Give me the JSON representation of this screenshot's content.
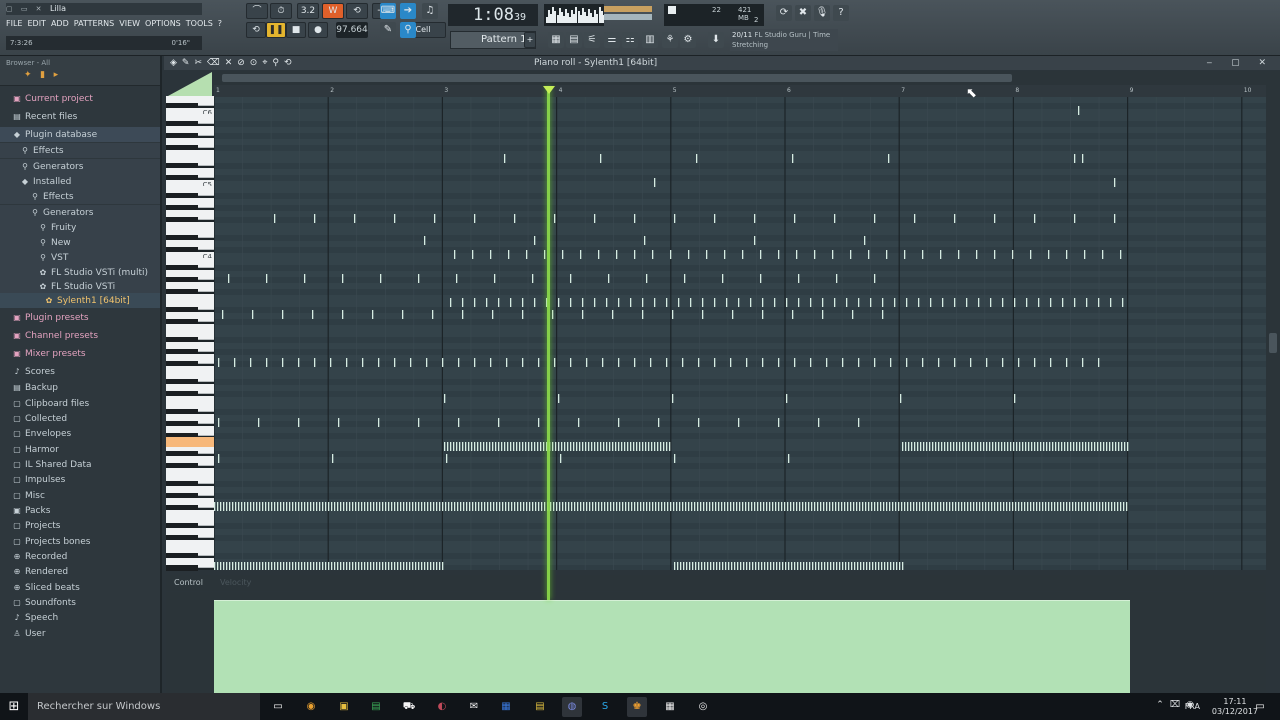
{
  "window": {
    "title": "Lilla",
    "controls": "▢ ▭ ✕"
  },
  "menu": [
    "FILE",
    "EDIT",
    "ADD",
    "PATTERNS",
    "VIEW",
    "OPTIONS",
    "TOOLS",
    "?"
  ],
  "hint": {
    "left": "7:3:26",
    "right": "0'16\""
  },
  "transport": {
    "tempo": "97.664",
    "time_main": "1:08",
    "time_sub": "39",
    "time_unit": "M:S:CS",
    "cell_label": "Cell",
    "beat_label": "3.2"
  },
  "cpu": {
    "a": "22",
    "b": "421 MB",
    "c": "2"
  },
  "pattern": {
    "label": "Pattern 1"
  },
  "news": {
    "counter": "20/11",
    "text": "FL Studio Guru | Time Stretching"
  },
  "browser": {
    "header": "Browser - All",
    "items": [
      {
        "label": "Current project",
        "icon": "▣",
        "kind": "pink"
      },
      {
        "label": "Recent files",
        "icon": "▤",
        "kind": "normal"
      },
      {
        "label": "Plugin database",
        "icon": "◆",
        "kind": "hdr"
      },
      {
        "label": "Effects",
        "icon": "⚲",
        "kind": "sub"
      },
      {
        "label": "Generators",
        "icon": "⚲",
        "kind": "sub"
      },
      {
        "label": "Installed",
        "icon": "◆",
        "kind": "sub"
      },
      {
        "label": "Effects",
        "icon": "⚲",
        "kind": "sub"
      },
      {
        "label": "Generators",
        "icon": "⚲",
        "kind": "sub"
      },
      {
        "label": "Fruity",
        "icon": "⚲",
        "kind": "sub"
      },
      {
        "label": "New",
        "icon": "⚲",
        "kind": "sub"
      },
      {
        "label": "VST",
        "icon": "⚲",
        "kind": "sub"
      },
      {
        "label": "FL Studio VSTi (multi)",
        "icon": "✿",
        "kind": "sub"
      },
      {
        "label": "FL Studio VSTi",
        "icon": "✿",
        "kind": "sub"
      },
      {
        "label": "Sylenth1 [64bit]",
        "icon": "✿",
        "kind": "sel"
      },
      {
        "label": "Plugin presets",
        "icon": "▣",
        "kind": "pink"
      },
      {
        "label": "Channel presets",
        "icon": "▣",
        "kind": "pink"
      },
      {
        "label": "Mixer presets",
        "icon": "▣",
        "kind": "pink"
      },
      {
        "label": "Scores",
        "icon": "♪",
        "kind": "normal"
      },
      {
        "label": "Backup",
        "icon": "▤",
        "kind": "normal"
      },
      {
        "label": "Clipboard files",
        "icon": "▢",
        "kind": "normal"
      },
      {
        "label": "Collected",
        "icon": "▢",
        "kind": "normal"
      },
      {
        "label": "Envelopes",
        "icon": "▢",
        "kind": "normal"
      },
      {
        "label": "Harmor",
        "icon": "▢",
        "kind": "normal"
      },
      {
        "label": "IL Shared Data",
        "icon": "▢",
        "kind": "normal"
      },
      {
        "label": "Impulses",
        "icon": "▢",
        "kind": "normal"
      },
      {
        "label": "Misc",
        "icon": "▢",
        "kind": "normal"
      },
      {
        "label": "Packs",
        "icon": "▣",
        "kind": "normal"
      },
      {
        "label": "Projects",
        "icon": "▢",
        "kind": "normal"
      },
      {
        "label": "Projects bones",
        "icon": "▢",
        "kind": "normal"
      },
      {
        "label": "Recorded",
        "icon": "⊕",
        "kind": "normal"
      },
      {
        "label": "Rendered",
        "icon": "⊕",
        "kind": "normal"
      },
      {
        "label": "Sliced beats",
        "icon": "⊕",
        "kind": "normal"
      },
      {
        "label": "Soundfonts",
        "icon": "▢",
        "kind": "normal"
      },
      {
        "label": "Speech",
        "icon": "♪",
        "kind": "normal"
      },
      {
        "label": "User",
        "icon": "♙",
        "kind": "normal"
      }
    ]
  },
  "pianoroll": {
    "title": "Piano roll - Sylenth1 [64bit]",
    "tools": "◈✎✂⌫✕⊘⊙⌖⚲⟲",
    "window_controls": "‒ ▢ ✕",
    "bars": [
      "1",
      "2",
      "3",
      "4",
      "5",
      "6",
      "7",
      "8",
      "9",
      "10"
    ],
    "key_labels": [
      "C6",
      "C5",
      "C4"
    ],
    "control_label": "Control",
    "control_param": "Velocity"
  },
  "taskbar": {
    "search": "Rechercher sur Windows",
    "lang": "FRA",
    "time": "17:11",
    "date": "03/12/2017"
  }
}
